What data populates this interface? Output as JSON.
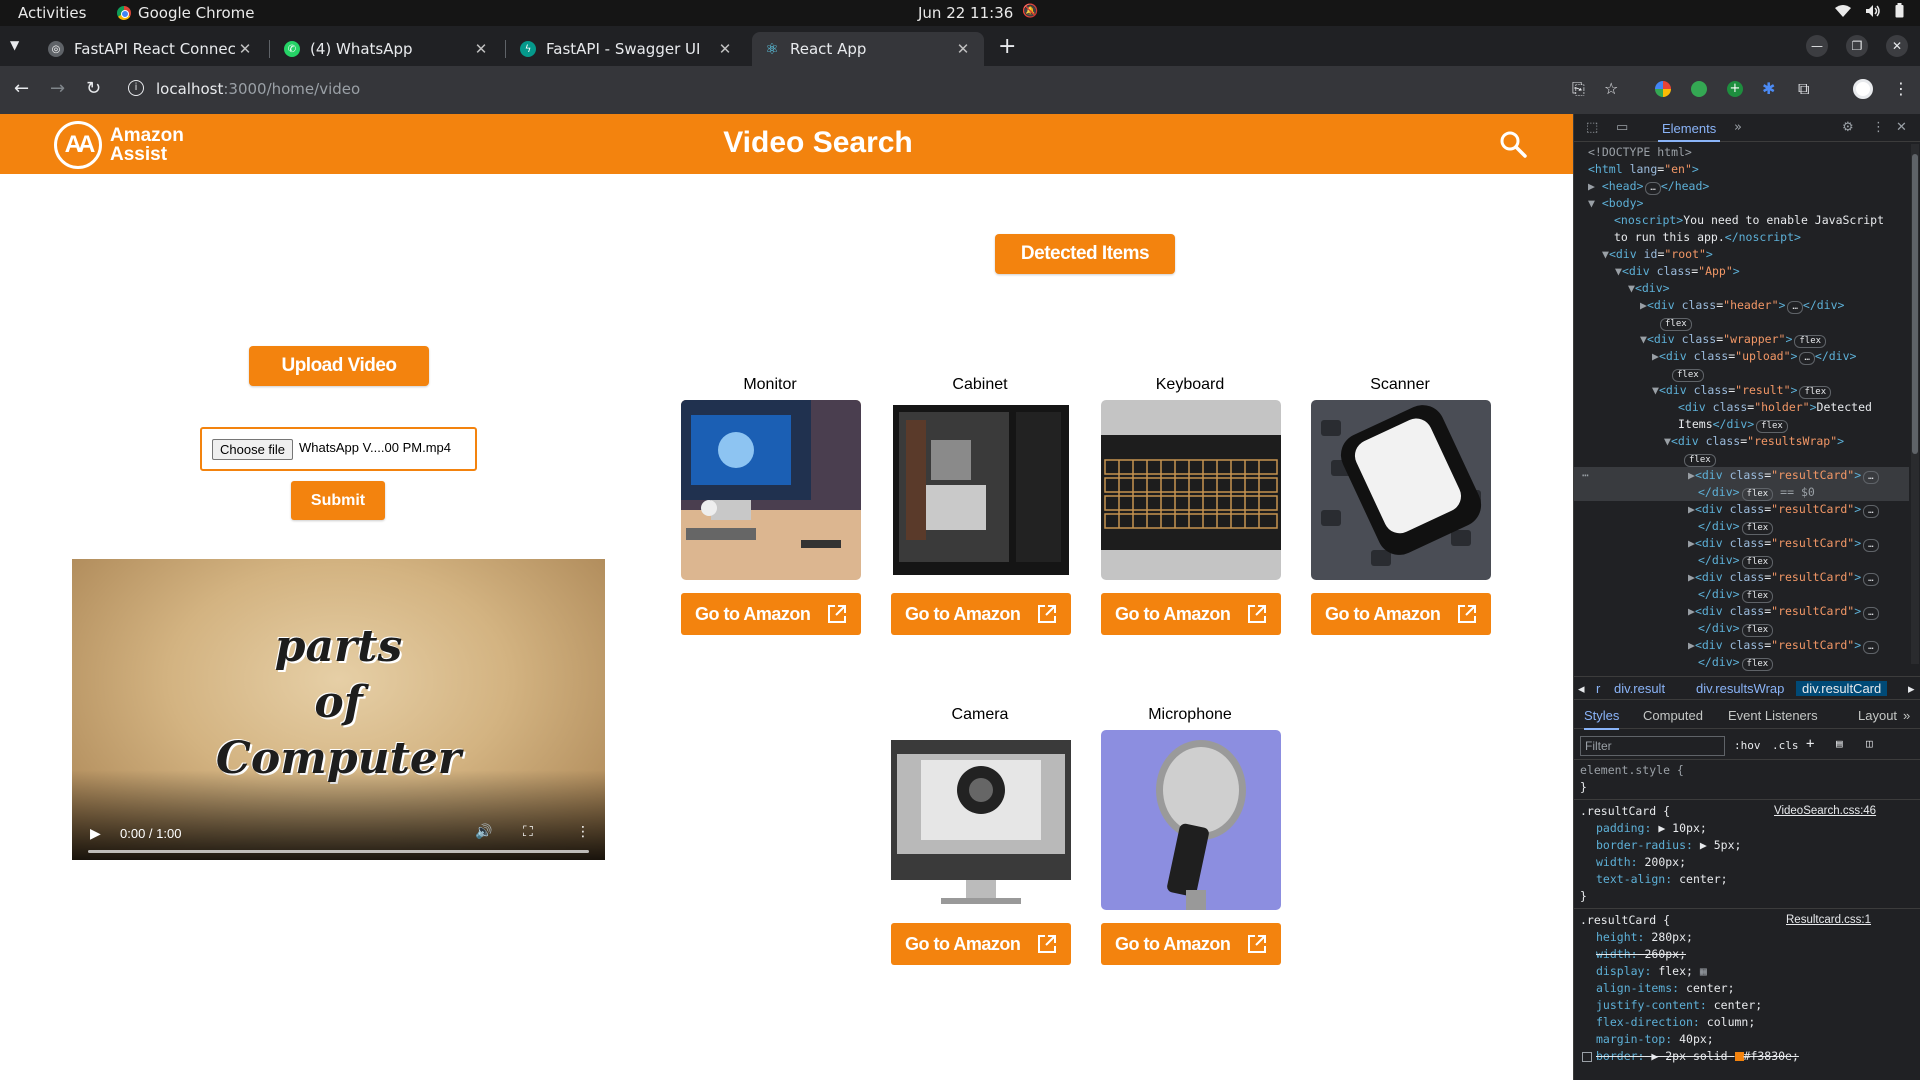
{
  "os_bar": {
    "activities": "Activities",
    "app_name": "Google Chrome",
    "clock": "Jun 22  11:36"
  },
  "browser": {
    "tabs": [
      {
        "title": "FastAPI React Connectio",
        "favicon": "globe-favicon",
        "active": false
      },
      {
        "title": "(4) WhatsApp",
        "favicon": "whatsapp-favicon",
        "active": false
      },
      {
        "title": "FastAPI - Swagger UI",
        "favicon": "fastapi-favicon",
        "active": false
      },
      {
        "title": "React App",
        "favicon": "react-favicon",
        "active": true
      }
    ],
    "url_host": "localhost",
    "url_path": ":3000/home/video"
  },
  "app": {
    "logo_line1": "Amazon",
    "logo_line2": "Assist",
    "logo_mark": "AA",
    "title": "Video Search",
    "detected_label": "Detected Items",
    "upload_label": "Upload Video",
    "choose_file_label": "Choose file",
    "file_name": "WhatsApp V....00 PM.mp4",
    "submit_label": "Submit",
    "accent_color": "#f3830e",
    "video": {
      "overlay_line1": "parts",
      "overlay_line2": "of",
      "overlay_line3": "Computer",
      "time": "0:00 / 1:00"
    },
    "results": [
      {
        "label": "Monitor",
        "button": "Go to Amazon"
      },
      {
        "label": "Cabinet",
        "button": "Go to Amazon"
      },
      {
        "label": "Keyboard",
        "button": "Go to Amazon"
      },
      {
        "label": "Scanner",
        "button": "Go to Amazon"
      },
      {
        "label": "Camera",
        "button": "Go to Amazon"
      },
      {
        "label": "Microphone",
        "button": "Go to Amazon"
      }
    ]
  },
  "devtools": {
    "panel_tab": "Elements",
    "dom": [
      "<!DOCTYPE html>",
      "html lang=\"en\"",
      "head … /head",
      "body",
      "noscript: You need to enable JavaScript",
      "to run this app.",
      "div id=\"root\"",
      "div class=\"App\"",
      "div",
      "div class=\"header\"",
      "div class=\"wrapper\"",
      "div class=\"upload\"",
      "div class=\"result\"",
      "div class=\"holder\": Detected",
      "Items",
      "div class=\"resultsWrap\"",
      "div class=\"resultCard\"",
      "== $0"
    ],
    "dom_texts": {
      "doctype": "<!DOCTYPE html>",
      "html_open": "<html",
      "lang_attr": "lang",
      "lang_val": "\"en\"",
      "head": "<head>",
      "head_close": "</head>",
      "body": "<body>",
      "noscript_open": "<noscript>",
      "noscript_text1": "You need to enable JavaScript",
      "noscript_text2": "to run this app.",
      "noscript_close": "</noscript>",
      "div_open": "<div",
      "div_close": "</div>",
      "id_attr": "id",
      "class_attr": "class",
      "root_val": "\"root\"",
      "app_val": "\"App\"",
      "header_val": "\"header\"",
      "wrapper_val": "\"wrapper\"",
      "upload_val": "\"upload\"",
      "result_val": "\"result\"",
      "holder_val": "\"holder\"",
      "holder_text1": "Detected",
      "holder_text2": "Items",
      "results_wrap_val": "\"resultsWrap\"",
      "result_card_val": "\"resultCard\"",
      "flex_badge": "flex",
      "selected_marker": "== $0"
    },
    "breadcrumbs": [
      "r",
      "div.result",
      "div.resultsWrap",
      "div.resultCard"
    ],
    "style_tabs": [
      "Styles",
      "Computed",
      "Event Listeners",
      "Layout"
    ],
    "filter_placeholder": "Filter",
    "filter_opts": [
      ":hov",
      ".cls"
    ],
    "styles": {
      "element_style": "element.style {",
      "close_brace": "}",
      "rule1_selector": ".resultCard {",
      "rule1_source": "VideoSearch.css:46",
      "rule1_props": [
        {
          "name": "padding:",
          "value": "▶ 10px;"
        },
        {
          "name": "border-radius:",
          "value": "▶ 5px;"
        },
        {
          "name": "width:",
          "value": "200px;"
        },
        {
          "name": "text-align:",
          "value": "center;"
        }
      ],
      "rule2_selector": ".resultCard {",
      "rule2_source": "Resultcard.css:1",
      "rule2_props": [
        {
          "name": "height:",
          "value": "280px;"
        },
        {
          "name": "width:",
          "value": "260px;"
        },
        {
          "name": "display:",
          "value": "flex;"
        },
        {
          "name": "align-items:",
          "value": "center;"
        },
        {
          "name": "justify-content:",
          "value": "center;"
        },
        {
          "name": "flex-direction:",
          "value": "column;"
        },
        {
          "name": "margin-top:",
          "value": "40px;"
        },
        {
          "name": "border:",
          "value": "▶ 2px solid"
        }
      ],
      "border_color_text": "#f3830e;"
    }
  }
}
